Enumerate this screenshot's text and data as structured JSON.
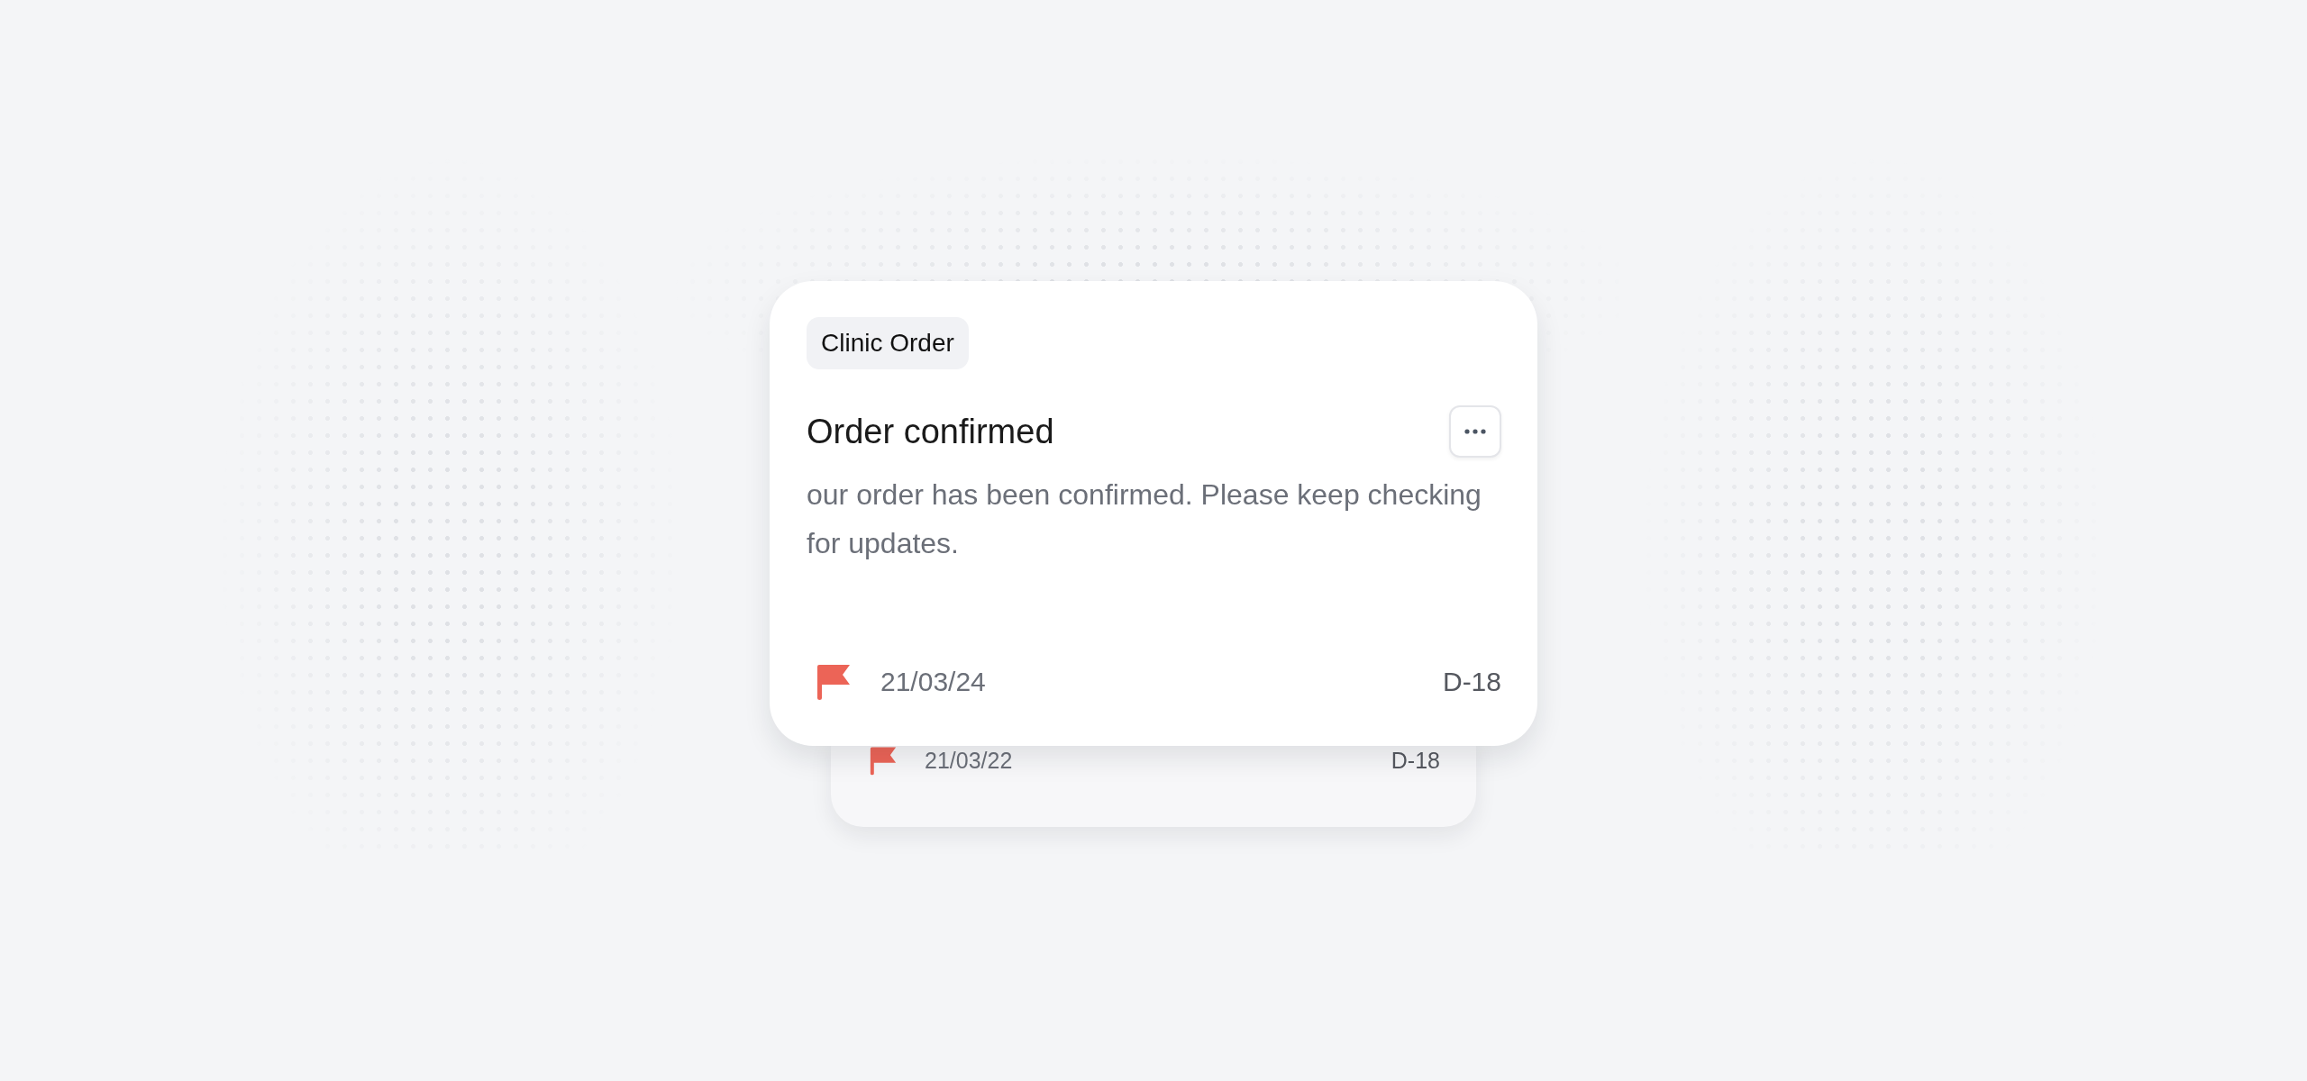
{
  "front_card": {
    "tag": "Clinic Order",
    "title": "Order confirmed",
    "body": "our order has been confirmed. Please keep checking for updates.",
    "date": "21/03/24",
    "countdown": "D-18"
  },
  "back_card": {
    "date": "21/03/22",
    "countdown": "D-18"
  }
}
